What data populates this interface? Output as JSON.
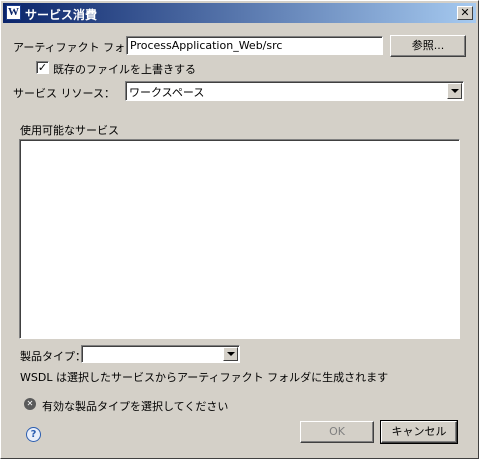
{
  "window": {
    "title": "サービス消費"
  },
  "artifact_folder": {
    "label": "アーティファクト フォルダ:",
    "value": "ProcessApplication_Web/src",
    "browse_label": "参照..."
  },
  "overwrite": {
    "label": "既存のファイルを上書きする",
    "checked": true,
    "check_glyph": "✓"
  },
  "service_resource": {
    "label": "サービス リソース：",
    "selected": "ワークスペース"
  },
  "services": {
    "label": "使用可能なサービス",
    "items": []
  },
  "product_type": {
    "label": "製品タイプ：",
    "selected": ""
  },
  "info_text": "WSDL は選択したサービスからアーティファクト フォルダに生成されます",
  "error": {
    "icon": "error-icon",
    "message": "有効な製品タイプを選択してください"
  },
  "footer": {
    "ok_label": "OK",
    "cancel_label": "キャンセル",
    "help_icon": "help-icon"
  },
  "icons": {
    "app": "W",
    "close": "✕",
    "error_glyph": "✕",
    "help_glyph": "?"
  },
  "colors": {
    "title_start": "#0a246a",
    "title_end": "#a6caf0",
    "error": "#d04040",
    "help": "#2a5db0"
  }
}
